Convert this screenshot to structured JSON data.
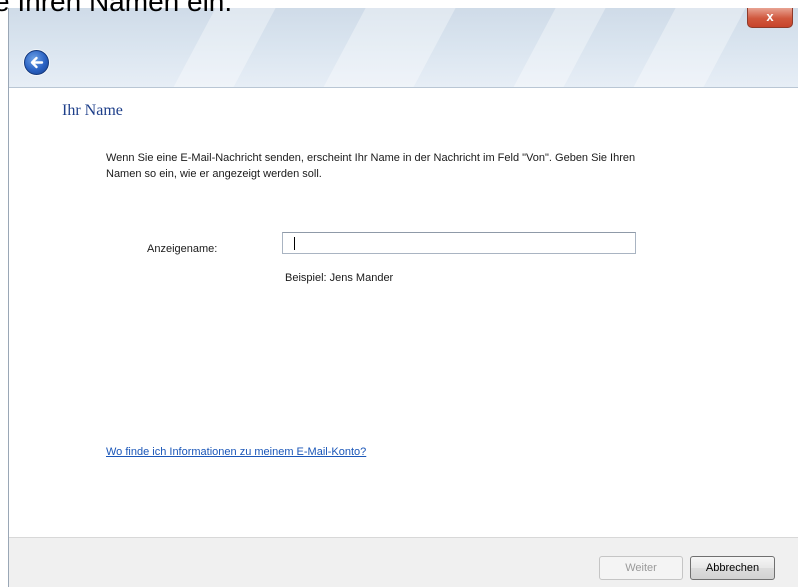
{
  "caption": {
    "text": "e Ihren Namen ein."
  },
  "window": {
    "close_label": "x",
    "back_icon": "back-arrow-icon"
  },
  "content": {
    "title": "Ihr Name",
    "description": "Wenn Sie eine E-Mail-Nachricht senden, erscheint Ihr Name in der Nachricht im Feld \"Von\". Geben Sie Ihren Namen so ein, wie er angezeigt werden soll.",
    "field_label": "Anzeigename:",
    "field_value": "",
    "example": "Beispiel: Jens Mander",
    "help_link": "Wo finde ich Informationen zu meinem E-Mail-Konto?"
  },
  "footer": {
    "next_label": "Weiter",
    "cancel_label": "Abbrechen"
  },
  "colors": {
    "title": "#1e3f8a",
    "link": "#1a56b8",
    "close_button": "#c7432a"
  }
}
